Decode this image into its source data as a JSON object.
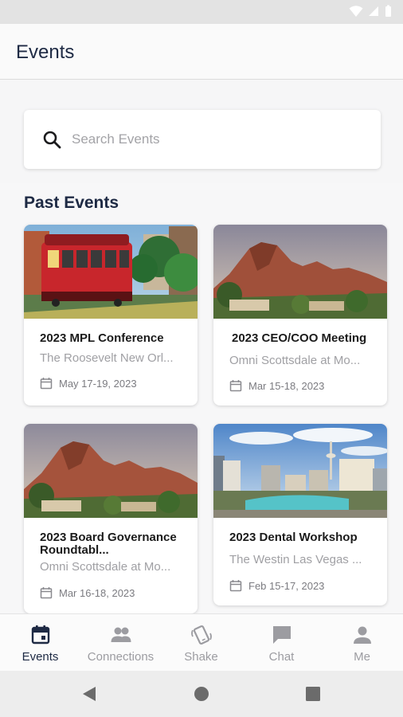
{
  "header": {
    "title": "Events"
  },
  "search": {
    "placeholder": "Search Events"
  },
  "section": {
    "title": "Past Events"
  },
  "events": [
    {
      "title": "2023 MPL Conference",
      "venue": "The Roosevelt New Orl...",
      "date": "May 17-19, 2023",
      "image": "streetcar"
    },
    {
      "title": "2023 CEO/COO Meeting",
      "venue": "Omni Scottsdale at Mo...",
      "date": "Mar 15-18, 2023",
      "image": "desert-mountain"
    },
    {
      "title": "2023 Board Governance Roundtabl...",
      "venue": "Omni Scottsdale at Mo...",
      "date": "Mar 16-18, 2023",
      "image": "desert-mountain"
    },
    {
      "title": "2023 Dental Workshop",
      "venue": "The Westin Las Vegas ...",
      "date": "Feb 15-17, 2023",
      "image": "las-vegas-skyline"
    }
  ],
  "bottom_nav": [
    {
      "label": "Events",
      "icon": "calendar-icon",
      "active": true
    },
    {
      "label": "Connections",
      "icon": "people-icon",
      "active": false
    },
    {
      "label": "Shake",
      "icon": "shake-phone-icon",
      "active": false
    },
    {
      "label": "Chat",
      "icon": "chat-bubble-icon",
      "active": false
    },
    {
      "label": "Me",
      "icon": "person-icon",
      "active": false
    }
  ],
  "colors": {
    "accent": "#1e2a44",
    "inactive": "#9c9ca1",
    "background": "#f7f7f8"
  }
}
